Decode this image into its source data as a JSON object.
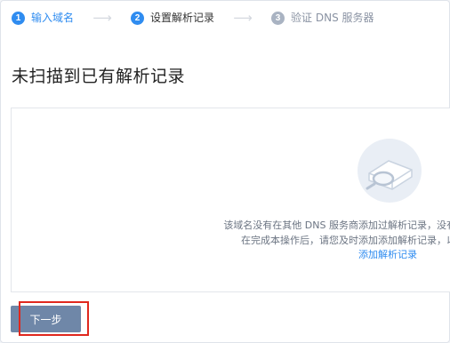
{
  "steps": [
    {
      "num": "1",
      "label": "输入域名",
      "state": "done"
    },
    {
      "num": "2",
      "label": "设置解析记录",
      "state": "active"
    },
    {
      "num": "3",
      "label": "验证 DNS 服务器",
      "state": "todo"
    }
  ],
  "step_arrow": "⟶",
  "page_title": "未扫描到已有解析记录",
  "empty_state": {
    "line1": "该域名没有在其他 DNS 服务商添加过解析记录，没有",
    "line2": "在完成本操作后，请您及时添加添加解析记录，以",
    "link": "添加解析记录"
  },
  "next_button": "下一步",
  "colors": {
    "accent": "#2f8cf0",
    "button": "#6f87a8",
    "highlight": "#e0281e"
  }
}
